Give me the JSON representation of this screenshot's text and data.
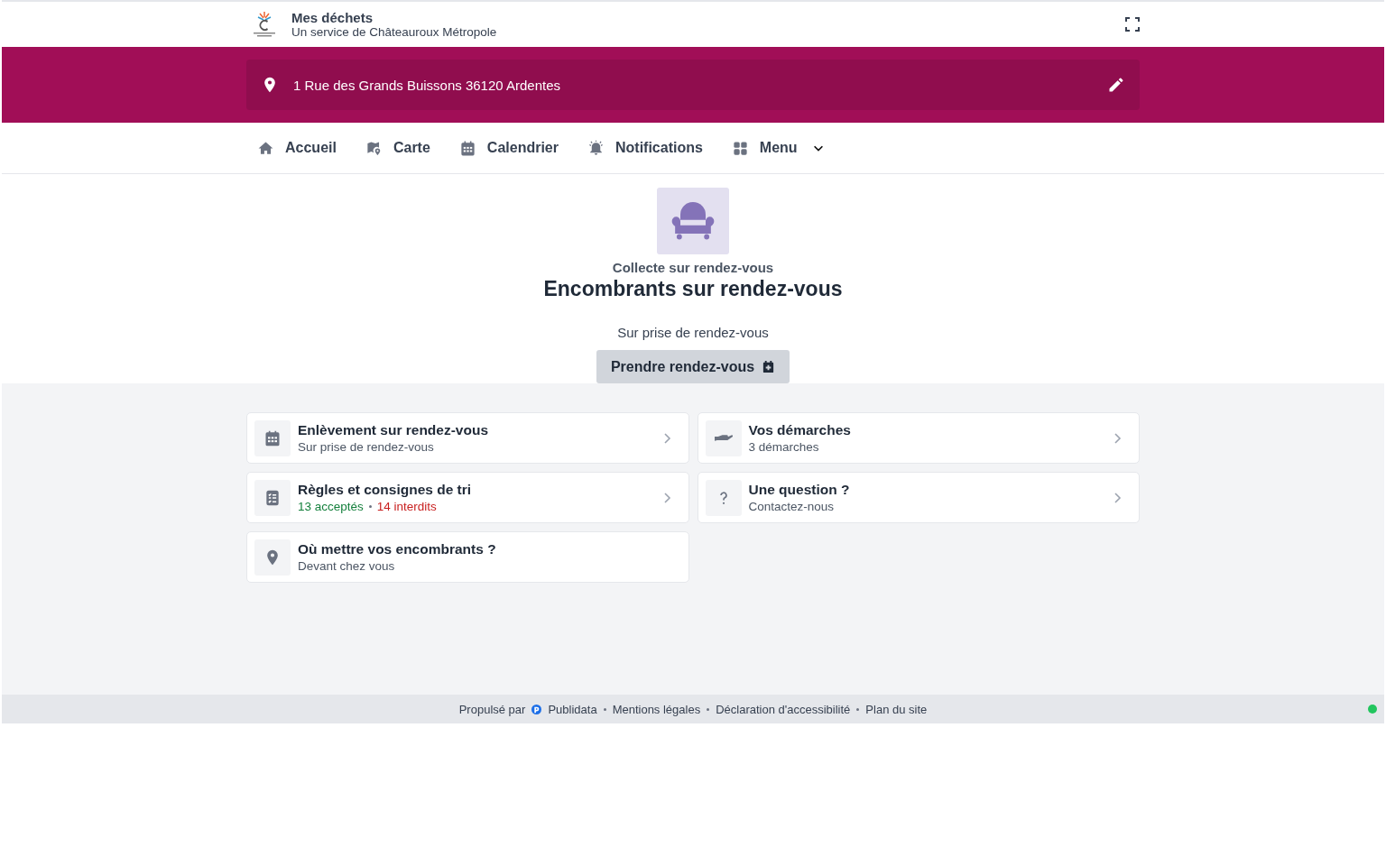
{
  "header": {
    "title": "Mes déchets",
    "subtitle": "Un service de Châteauroux Métropole"
  },
  "address": {
    "text": "1 Rue des Grands Buissons 36120 Ardentes"
  },
  "nav": [
    {
      "kind": "home",
      "label": "Accueil"
    },
    {
      "kind": "map",
      "label": "Carte"
    },
    {
      "kind": "calendar",
      "label": "Calendrier"
    },
    {
      "kind": "bell",
      "label": "Notifications"
    },
    {
      "kind": "grid",
      "label": "Menu",
      "dropdown": true
    }
  ],
  "hero": {
    "eyebrow": "Collecte sur rendez-vous",
    "title": "Encombrants sur rendez-vous",
    "description": "Sur prise de rendez-vous",
    "button": "Prendre rendez-vous"
  },
  "cards": [
    {
      "kind": "calendar",
      "title": "Enlèvement sur rendez-vous",
      "subtitle": "Sur prise de rendez-vous",
      "chevron": true
    },
    {
      "kind": "hand",
      "title": "Vos démarches",
      "subtitle": "3 démarches",
      "chevron": true
    },
    {
      "kind": "list",
      "title": "Règles et consignes de tri",
      "counts": [
        {
          "number": "13",
          "label": "acceptés",
          "color": "#15803d"
        },
        {
          "number": "14",
          "label": "interdits",
          "color": "#c81e1e"
        }
      ],
      "chevron": true
    },
    {
      "kind": "question",
      "title": "Une question ?",
      "subtitle": "Contactez-nous",
      "chevron": true
    },
    {
      "kind": "pin",
      "title": "Où mettre vos encombrants ?",
      "subtitle": "Devant chez vous",
      "chevron": false
    }
  ],
  "footer": {
    "powered_by": "Propulsé par",
    "links": [
      "Publidata",
      "Mentions légales",
      "Déclaration d'accessibilité",
      "Plan du site"
    ]
  }
}
